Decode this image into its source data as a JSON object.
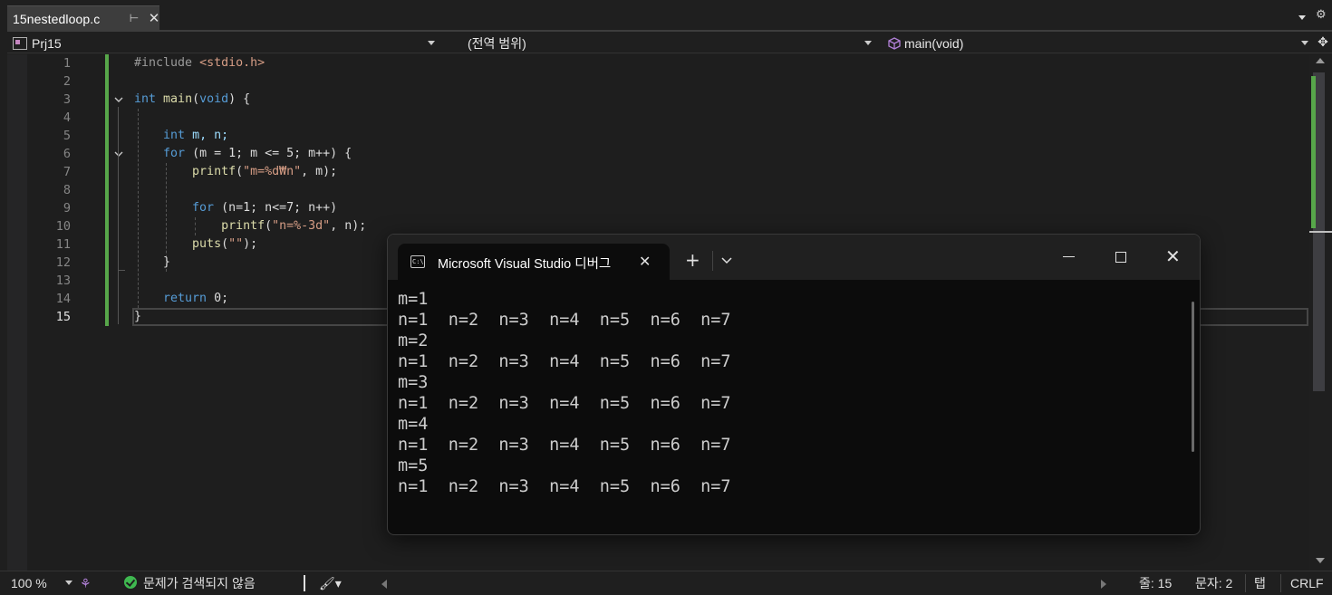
{
  "tab": {
    "file_name": "15nestedloop.c",
    "pin_icon": "pin-icon",
    "close_icon": "close-icon"
  },
  "nav": {
    "project": "Prj15",
    "scope": "(전역 범위)",
    "function": "main(void)"
  },
  "code_lines": [
    "1",
    "2",
    "3",
    "4",
    "5",
    "6",
    "7",
    "8",
    "9",
    "10",
    "11",
    "12",
    "13",
    "14",
    "15"
  ],
  "code": {
    "l1_pp": "#include ",
    "l1_hdr": "<stdio.h>",
    "l3_kw": "int",
    "l3_fn": "main",
    "l3_rest": "(",
    "l3_void": "void",
    "l3_end": ") {",
    "l5_kw": "int",
    "l5_rest": " m, n;",
    "l6_kw": "for",
    "l6_rest": " (m = 1; m <= 5; m++) {",
    "l7_fn": "printf",
    "l7_open": "(",
    "l7_str": "\"m=%d₩n\"",
    "l7_rest": ", m);",
    "l9_kw": "for",
    "l9_rest": " (n=1; n<=7; n++)",
    "l10_fn": "printf",
    "l10_open": "(",
    "l10_str": "\"n=%-3d\"",
    "l10_rest": ", n);",
    "l11_fn": "puts",
    "l11_open": "(",
    "l11_str": "\"\"",
    "l11_rest": ");",
    "l12": "}",
    "l14_kw": "return",
    "l14_rest": " 0;",
    "l15": "}"
  },
  "terminal": {
    "title": "Microsoft Visual Studio 디버그",
    "new_tab": "+",
    "output": [
      "m=1",
      "n=1  n=2  n=3  n=4  n=5  n=6  n=7",
      "m=2",
      "n=1  n=2  n=3  n=4  n=5  n=6  n=7",
      "m=3",
      "n=1  n=2  n=3  n=4  n=5  n=6  n=7",
      "m=4",
      "n=1  n=2  n=3  n=4  n=5  n=6  n=7",
      "m=5",
      "n=1  n=2  n=3  n=4  n=5  n=6  n=7"
    ]
  },
  "status": {
    "zoom": "100 %",
    "issues": "문제가 검색되지 않음",
    "line": "줄: 15",
    "col": "문자: 2",
    "tab_mode": "탭",
    "eol": "CRLF"
  },
  "colors": {
    "keyword": "#569cd6",
    "string": "#d69d85",
    "function": "#dcdcaa",
    "change_bar": "#57a64a"
  }
}
